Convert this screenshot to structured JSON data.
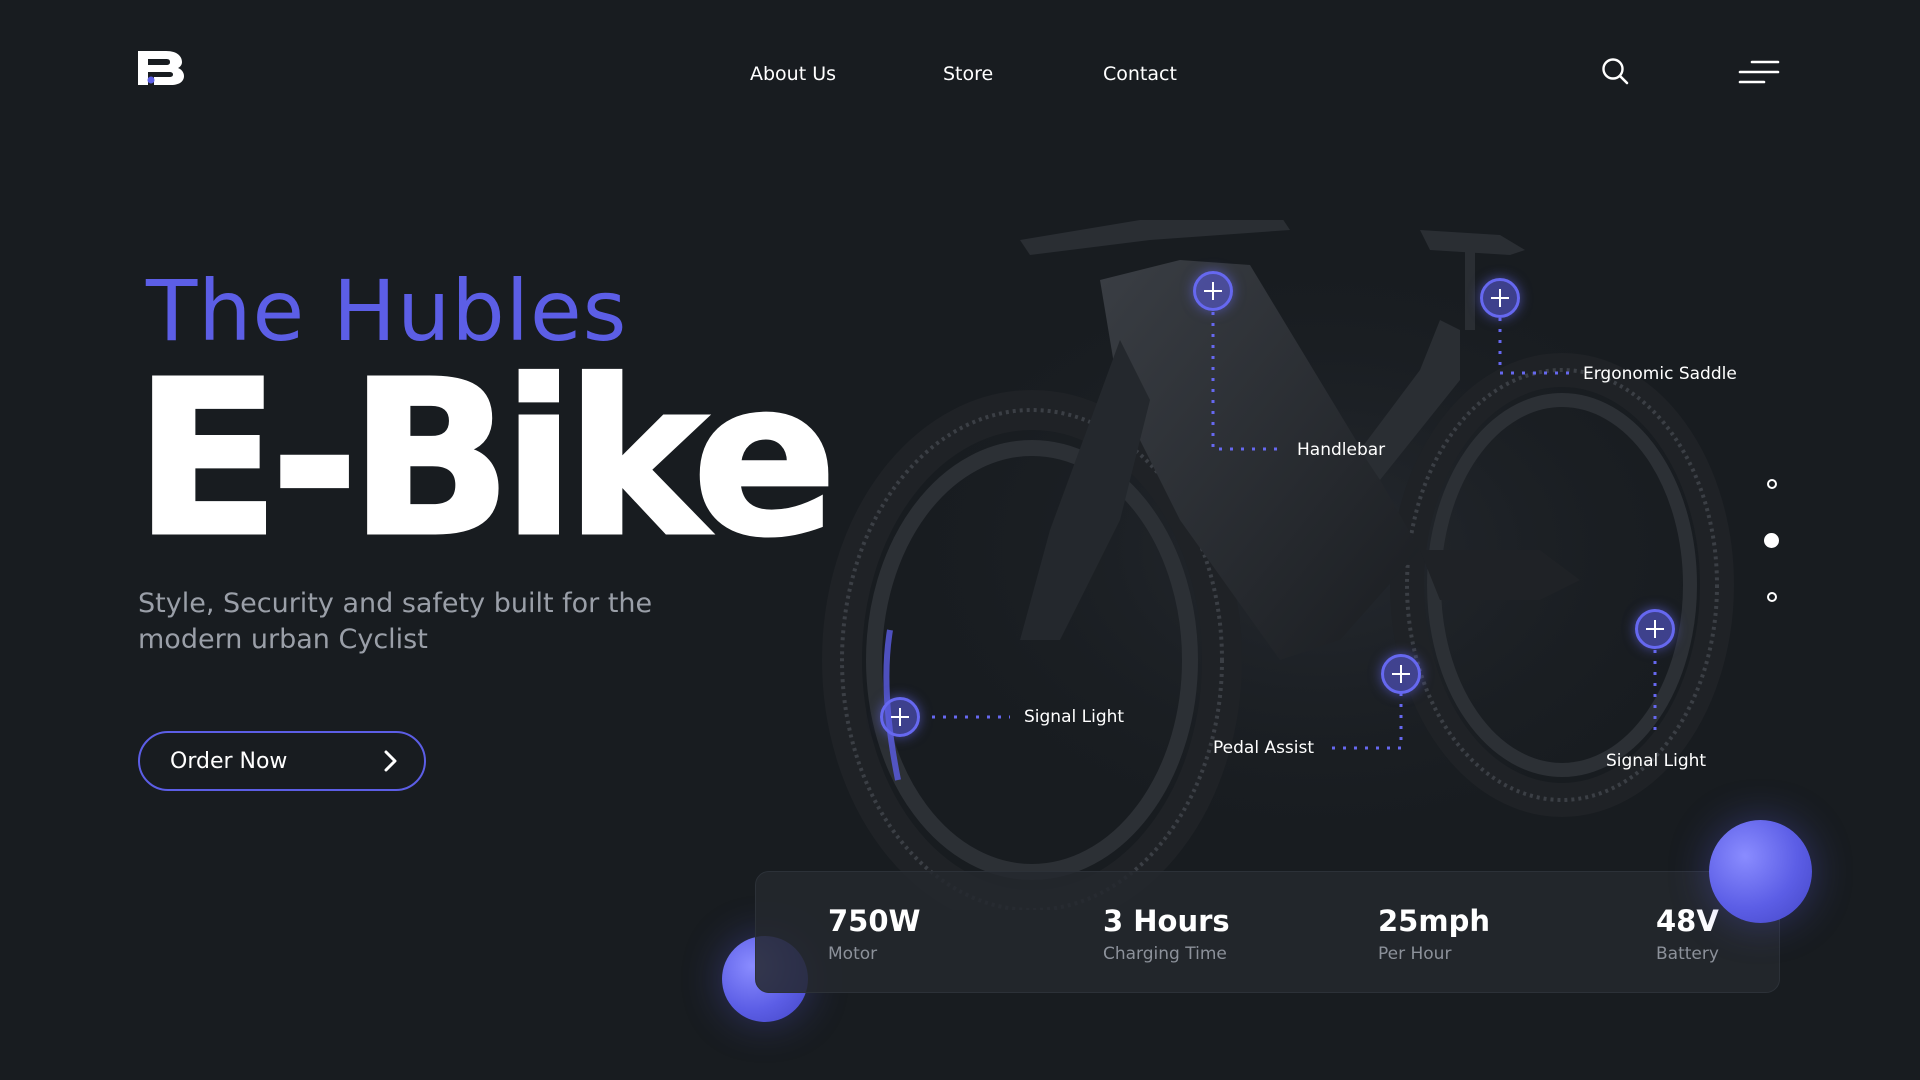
{
  "brand": {
    "logo_text": "B",
    "accent": "#5c5ee6"
  },
  "nav": {
    "items": [
      {
        "label": "About Us"
      },
      {
        "label": "Store"
      },
      {
        "label": "Contact"
      }
    ],
    "icons": [
      "search-icon",
      "menu-icon"
    ]
  },
  "hero": {
    "subtitle": "The Hubles",
    "title": "E-Bike",
    "description": "Style, Security and safety built for the modern urban Cyclist",
    "cta_label": "Order Now"
  },
  "callouts": [
    {
      "label": "Handlebar"
    },
    {
      "label": "Ergonomic Saddle"
    },
    {
      "label": "Signal Light"
    },
    {
      "label": "Pedal Assist"
    },
    {
      "label": "Signal Light"
    }
  ],
  "slider": {
    "count": 3,
    "active_index": 1
  },
  "specs": [
    {
      "value": "750W",
      "label": "Motor"
    },
    {
      "value": "3 Hours",
      "label": "Charging Time"
    },
    {
      "value": "25mph",
      "label": "Per Hour"
    },
    {
      "value": "48V",
      "label": "Battery"
    }
  ]
}
